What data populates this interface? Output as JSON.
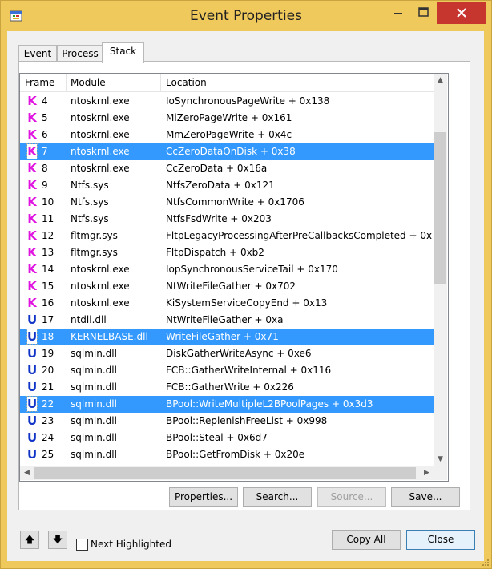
{
  "window": {
    "title": "Event Properties"
  },
  "tabs": [
    "Event",
    "Process",
    "Stack"
  ],
  "list": {
    "columns": [
      "Frame",
      "Module",
      "Location"
    ],
    "rows": [
      {
        "kind": "K",
        "frame": "4",
        "module": "ntoskrnl.exe",
        "location": "IoSynchronousPageWrite + 0x138",
        "selected": false
      },
      {
        "kind": "K",
        "frame": "5",
        "module": "ntoskrnl.exe",
        "location": "MiZeroPageWrite + 0x161",
        "selected": false
      },
      {
        "kind": "K",
        "frame": "6",
        "module": "ntoskrnl.exe",
        "location": "MmZeroPageWrite + 0x4c",
        "selected": false
      },
      {
        "kind": "K",
        "frame": "7",
        "module": "ntoskrnl.exe",
        "location": "CcZeroDataOnDisk + 0x38",
        "selected": true
      },
      {
        "kind": "K",
        "frame": "8",
        "module": "ntoskrnl.exe",
        "location": "CcZeroData + 0x16a",
        "selected": false
      },
      {
        "kind": "K",
        "frame": "9",
        "module": "Ntfs.sys",
        "location": "NtfsZeroData + 0x121",
        "selected": false
      },
      {
        "kind": "K",
        "frame": "10",
        "module": "Ntfs.sys",
        "location": "NtfsCommonWrite + 0x1706",
        "selected": false
      },
      {
        "kind": "K",
        "frame": "11",
        "module": "Ntfs.sys",
        "location": "NtfsFsdWrite + 0x203",
        "selected": false
      },
      {
        "kind": "K",
        "frame": "12",
        "module": "fltmgr.sys",
        "location": "FltpLegacyProcessingAfterPreCallbacksCompleted + 0x",
        "selected": false
      },
      {
        "kind": "K",
        "frame": "13",
        "module": "fltmgr.sys",
        "location": "FltpDispatch + 0xb2",
        "selected": false
      },
      {
        "kind": "K",
        "frame": "14",
        "module": "ntoskrnl.exe",
        "location": "IopSynchronousServiceTail + 0x170",
        "selected": false
      },
      {
        "kind": "K",
        "frame": "15",
        "module": "ntoskrnl.exe",
        "location": "NtWriteFileGather + 0x702",
        "selected": false
      },
      {
        "kind": "K",
        "frame": "16",
        "module": "ntoskrnl.exe",
        "location": "KiSystemServiceCopyEnd + 0x13",
        "selected": false
      },
      {
        "kind": "U",
        "frame": "17",
        "module": "ntdll.dll",
        "location": "NtWriteFileGather + 0xa",
        "selected": false
      },
      {
        "kind": "U",
        "frame": "18",
        "module": "KERNELBASE.dll",
        "location": "WriteFileGather + 0x71",
        "selected": true
      },
      {
        "kind": "U",
        "frame": "19",
        "module": "sqlmin.dll",
        "location": "DiskGatherWriteAsync + 0xe6",
        "selected": false
      },
      {
        "kind": "U",
        "frame": "20",
        "module": "sqlmin.dll",
        "location": "FCB::GatherWriteInternal + 0x116",
        "selected": false
      },
      {
        "kind": "U",
        "frame": "21",
        "module": "sqlmin.dll",
        "location": "FCB::GatherWrite + 0x226",
        "selected": false
      },
      {
        "kind": "U",
        "frame": "22",
        "module": "sqlmin.dll",
        "location": "BPool::WriteMultipleL2BPoolPages + 0x3d3",
        "selected": true
      },
      {
        "kind": "U",
        "frame": "23",
        "module": "sqlmin.dll",
        "location": "BPool::ReplenishFreeList + 0x998",
        "selected": false
      },
      {
        "kind": "U",
        "frame": "24",
        "module": "sqlmin.dll",
        "location": "BPool::Steal + 0x6d7",
        "selected": false
      },
      {
        "kind": "U",
        "frame": "25",
        "module": "sqlmin.dll",
        "location": "BPool::GetFromDisk + 0x20e",
        "selected": false
      }
    ]
  },
  "buttons": {
    "properties": "Properties...",
    "search": "Search...",
    "source": "Source...",
    "save": "Save...",
    "copy_all": "Copy All",
    "close": "Close"
  },
  "next_highlighted": {
    "label": "Next Highlighted",
    "checked": false
  },
  "icons": {
    "up": "up-arrow-icon",
    "down": "down-arrow-icon",
    "kernel_frame": "kernel-frame-icon",
    "user_frame": "user-frame-icon"
  },
  "colors": {
    "titlebar": "#f0c95c",
    "selection": "#3399ff",
    "kernel_icon": "#e016e0",
    "user_icon": "#1033c7",
    "close_button": "#c7362e"
  }
}
